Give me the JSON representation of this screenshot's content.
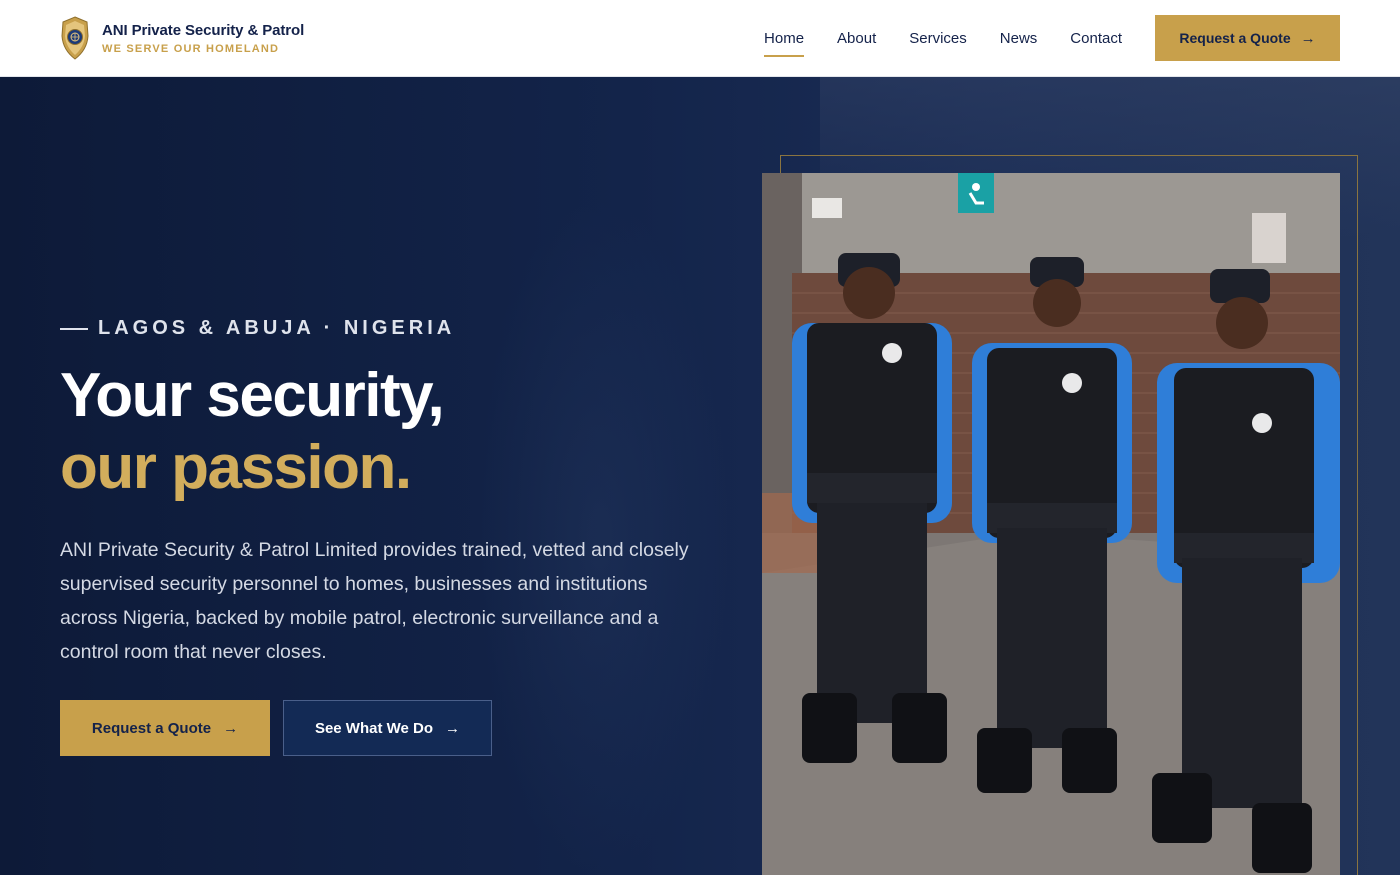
{
  "brand": {
    "name": "ANI Private Security & Patrol",
    "tagline": "WE SERVE OUR HOMELAND",
    "logo_icon": "police-badge-icon"
  },
  "nav": {
    "items": [
      {
        "label": "Home",
        "active": true
      },
      {
        "label": "About",
        "active": false
      },
      {
        "label": "Services",
        "active": false
      },
      {
        "label": "News",
        "active": false
      },
      {
        "label": "Contact",
        "active": false
      }
    ],
    "cta_label": "Request a Quote",
    "cta_icon": "arrow-right-icon"
  },
  "hero": {
    "eyebrow": "LAGOS & ABUJA · NIGERIA",
    "headline_line1": "Your security,",
    "headline_line2": "our passion.",
    "description": "ANI Private Security & Patrol Limited provides trained, vetted and closely supervised security personnel to homes, businesses and institutions across Nigeria, backed by mobile patrol, electronic surveillance and a control room that never closes.",
    "primary_cta": "Request a Quote",
    "secondary_cta": "See What We Do",
    "image": "three-security-guards-in-uniform-photo"
  },
  "colors": {
    "navy": "#0f1d3c",
    "gold": "#c8a04b",
    "gold_text": "#d2ad5c",
    "white": "#ffffff"
  }
}
